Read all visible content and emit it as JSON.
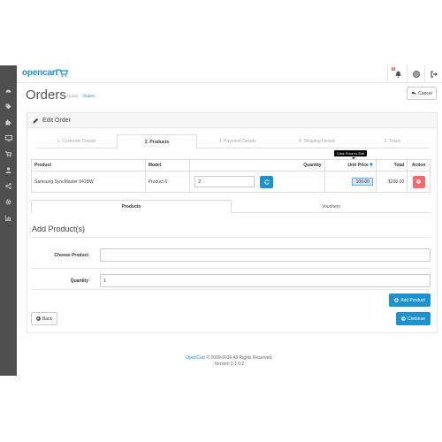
{
  "header": {
    "logo_text": "opencart",
    "notification_count": "5"
  },
  "sidebar": {
    "items": [
      {
        "icon": "dashboard-icon"
      },
      {
        "icon": "tags-icon"
      },
      {
        "icon": "puzzle-icon"
      },
      {
        "icon": "television-icon"
      },
      {
        "icon": "shopping-cart-icon"
      },
      {
        "icon": "user-icon"
      },
      {
        "icon": "share-icon"
      },
      {
        "icon": "cog-icon"
      },
      {
        "icon": "bar-chart-icon"
      }
    ]
  },
  "page": {
    "title": "Orders",
    "breadcrumb": [
      "Home",
      "Orders"
    ],
    "cancel_label": "Cancel",
    "panel_title": "Edit Order"
  },
  "step_tabs": [
    "1. Customer Details",
    "2. Products",
    "3. Payment Details",
    "4. Shipping Details",
    "5. Totals"
  ],
  "step_active": "2. Products",
  "tooltip": "Click Price to Edit",
  "cart_table": {
    "headers": {
      "product": "Product",
      "model": "Model",
      "quantity": "Quantity",
      "unit_price": "Unit Price",
      "total": "Total",
      "action": "Action"
    },
    "rows": [
      {
        "product": "Samsung SyncMaster 941BW",
        "model": "Product 6",
        "quantity": "2",
        "unit_price": "100.00",
        "total": "$200.00"
      }
    ]
  },
  "sub_tabs": [
    "Products",
    "Vouchers"
  ],
  "sub_tab_active": "Products",
  "add_products": {
    "title": "Add Product(s)",
    "choose_product_label": "Choose Product",
    "choose_product_value": "",
    "quantity_label": "Quantity",
    "quantity_value": "1",
    "add_button": "Add Product"
  },
  "nav_buttons": {
    "back": "Back",
    "continue": "Continue"
  },
  "footer": {
    "brand": "OpenCart",
    "copyright": "© 2009-2016 All Rights Reserved.",
    "version": "Version 2.1.0.2"
  },
  "colors": {
    "primary": "#1e91cf",
    "danger": "#f56b6b",
    "sidebar": "#4f4f4f"
  }
}
